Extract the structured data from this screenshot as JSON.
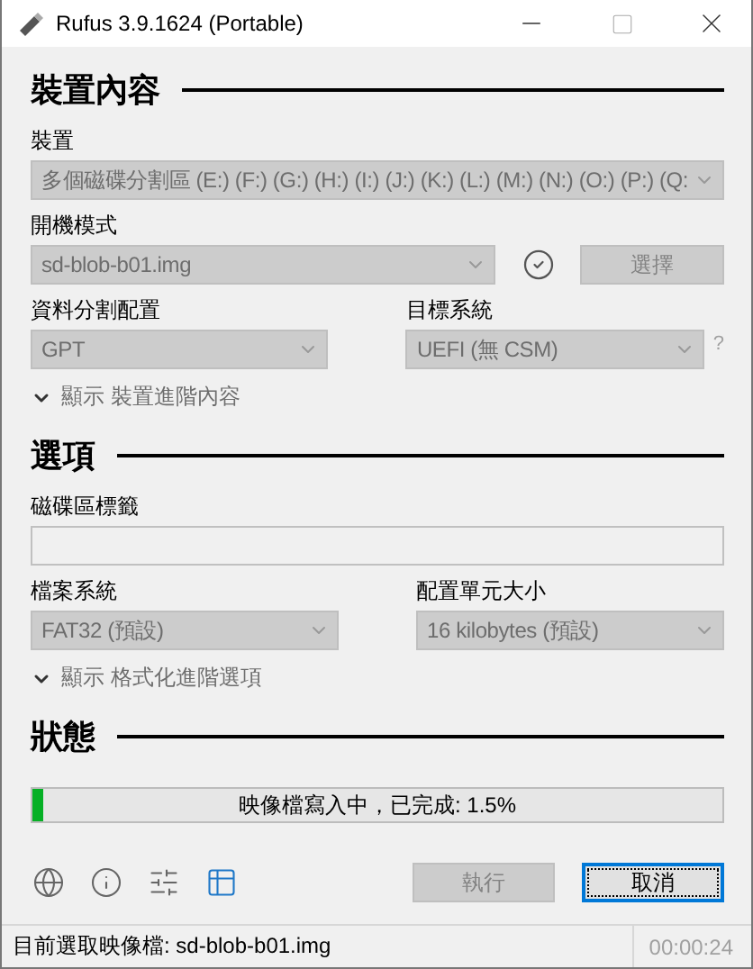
{
  "window": {
    "title": "Rufus 3.9.1624 (Portable)"
  },
  "drive_section": {
    "heading": "裝置內容",
    "device": {
      "label": "裝置",
      "value": "多個磁碟分割區 (E:) (F:) (G:) (H:) (I:) (J:) (K:) (L:) (M:) (N:) (O:) (P:) (Q:",
      "disabled": true
    },
    "boot": {
      "label": "開機模式",
      "value": "sd-blob-b01.img",
      "disabled": true,
      "select_button": "選擇",
      "select_disabled": true
    },
    "partition": {
      "label": "資料分割配置",
      "value": "GPT",
      "disabled": true
    },
    "target": {
      "label": "目標系統",
      "value": "UEFI (無 CSM)",
      "disabled": true,
      "help": "?"
    },
    "advanced": {
      "label": "顯示 裝置進階內容",
      "expanded": false
    }
  },
  "format_section": {
    "heading": "選項",
    "volume": {
      "label": "磁碟區標籤",
      "disabled": true
    },
    "filesystem": {
      "label": "檔案系統",
      "value": "FAT32 (預設)",
      "disabled": true
    },
    "cluster": {
      "label": "配置單元大小",
      "value": "16 kilobytes (預設)",
      "disabled": true
    },
    "advanced": {
      "label": "顯示 格式化進階選項",
      "expanded": false
    }
  },
  "status_section": {
    "heading": "狀態",
    "progress": {
      "text": "映像檔寫入中，已完成: 1.5%",
      "level": 0.015
    },
    "tools": [
      {
        "kind": "globe",
        "selected": false
      },
      {
        "kind": "info",
        "selected": false
      },
      {
        "kind": "settings",
        "selected": false
      },
      {
        "kind": "log",
        "selected": true
      }
    ],
    "buttons": [
      {
        "label": "執行",
        "disabled": true,
        "focused": false
      },
      {
        "label": "取消",
        "disabled": false,
        "focused": true
      }
    ]
  },
  "status_bar": {
    "text": "目前選取映像檔: sd-blob-b01.img",
    "timer": "00:00:24"
  }
}
